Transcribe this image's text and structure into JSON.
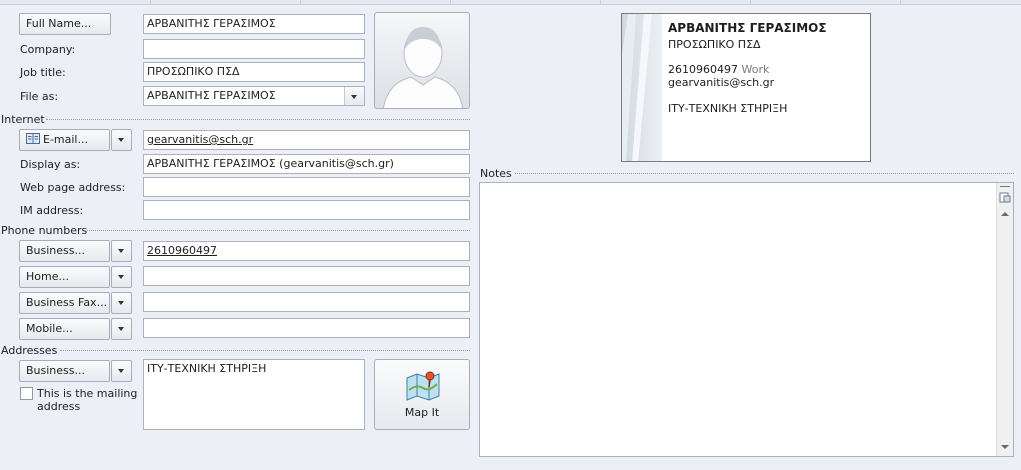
{
  "general": {
    "full_name_label": "Full Name...",
    "full_name_value": "ΑΡΒΑΝΙΤΗΣ ΓΕΡΑΣΙΜΟΣ",
    "company_label": "Company:",
    "company_value": "",
    "job_title_label": "Job title:",
    "job_title_value": "ΠΡΟΣΩΠΙΚΟ ΠΣΔ",
    "file_as_label": "File as:",
    "file_as_value": "ΑΡΒΑΝΙΤΗΣ ΓΕΡΑΣΙΜΟΣ"
  },
  "internet": {
    "section_label": "Internet",
    "email_button": "E-mail...",
    "email_value": "gearvanitis@sch.gr",
    "display_as_label": "Display as:",
    "display_as_value": "ΑΡΒΑΝΙΤΗΣ ΓΕΡΑΣΙΜΟΣ (gearvanitis@sch.gr)",
    "web_label": "Web page address:",
    "web_value": "",
    "im_label": "IM address:",
    "im_value": ""
  },
  "phones": {
    "section_label": "Phone numbers",
    "items": [
      {
        "label": "Business...",
        "value": "2610960497"
      },
      {
        "label": "Home...",
        "value": ""
      },
      {
        "label": "Business Fax...",
        "value": ""
      },
      {
        "label": "Mobile...",
        "value": ""
      }
    ]
  },
  "addresses": {
    "section_label": "Addresses",
    "type_button": "Business...",
    "address_value": "ΙΤΥ-ΤΕΧΝΙΚΗ ΣΤΗΡΙΞΗ",
    "mailing_label_1": "This is the mailing",
    "mailing_label_2": "address",
    "mailing_checked": false,
    "map_button": "Map It"
  },
  "business_card": {
    "name": "ΑΡΒΑΝΙΤΗΣ ΓΕΡΑΣΙΜΟΣ",
    "title": "ΠΡΟΣΩΠΙΚΟ ΠΣΔ",
    "phone": "2610960497",
    "phone_type": "Work",
    "email": "gearvanitis@sch.gr",
    "address": "ΙΤΥ-ΤΕΧΝΙΚΗ ΣΤΗΡΙΞΗ"
  },
  "notes": {
    "section_label": "Notes",
    "value": ""
  },
  "colors": {
    "background": "#ecf0f6",
    "field_border": "#a7b3c4",
    "button_border": "#a7aeb9"
  }
}
